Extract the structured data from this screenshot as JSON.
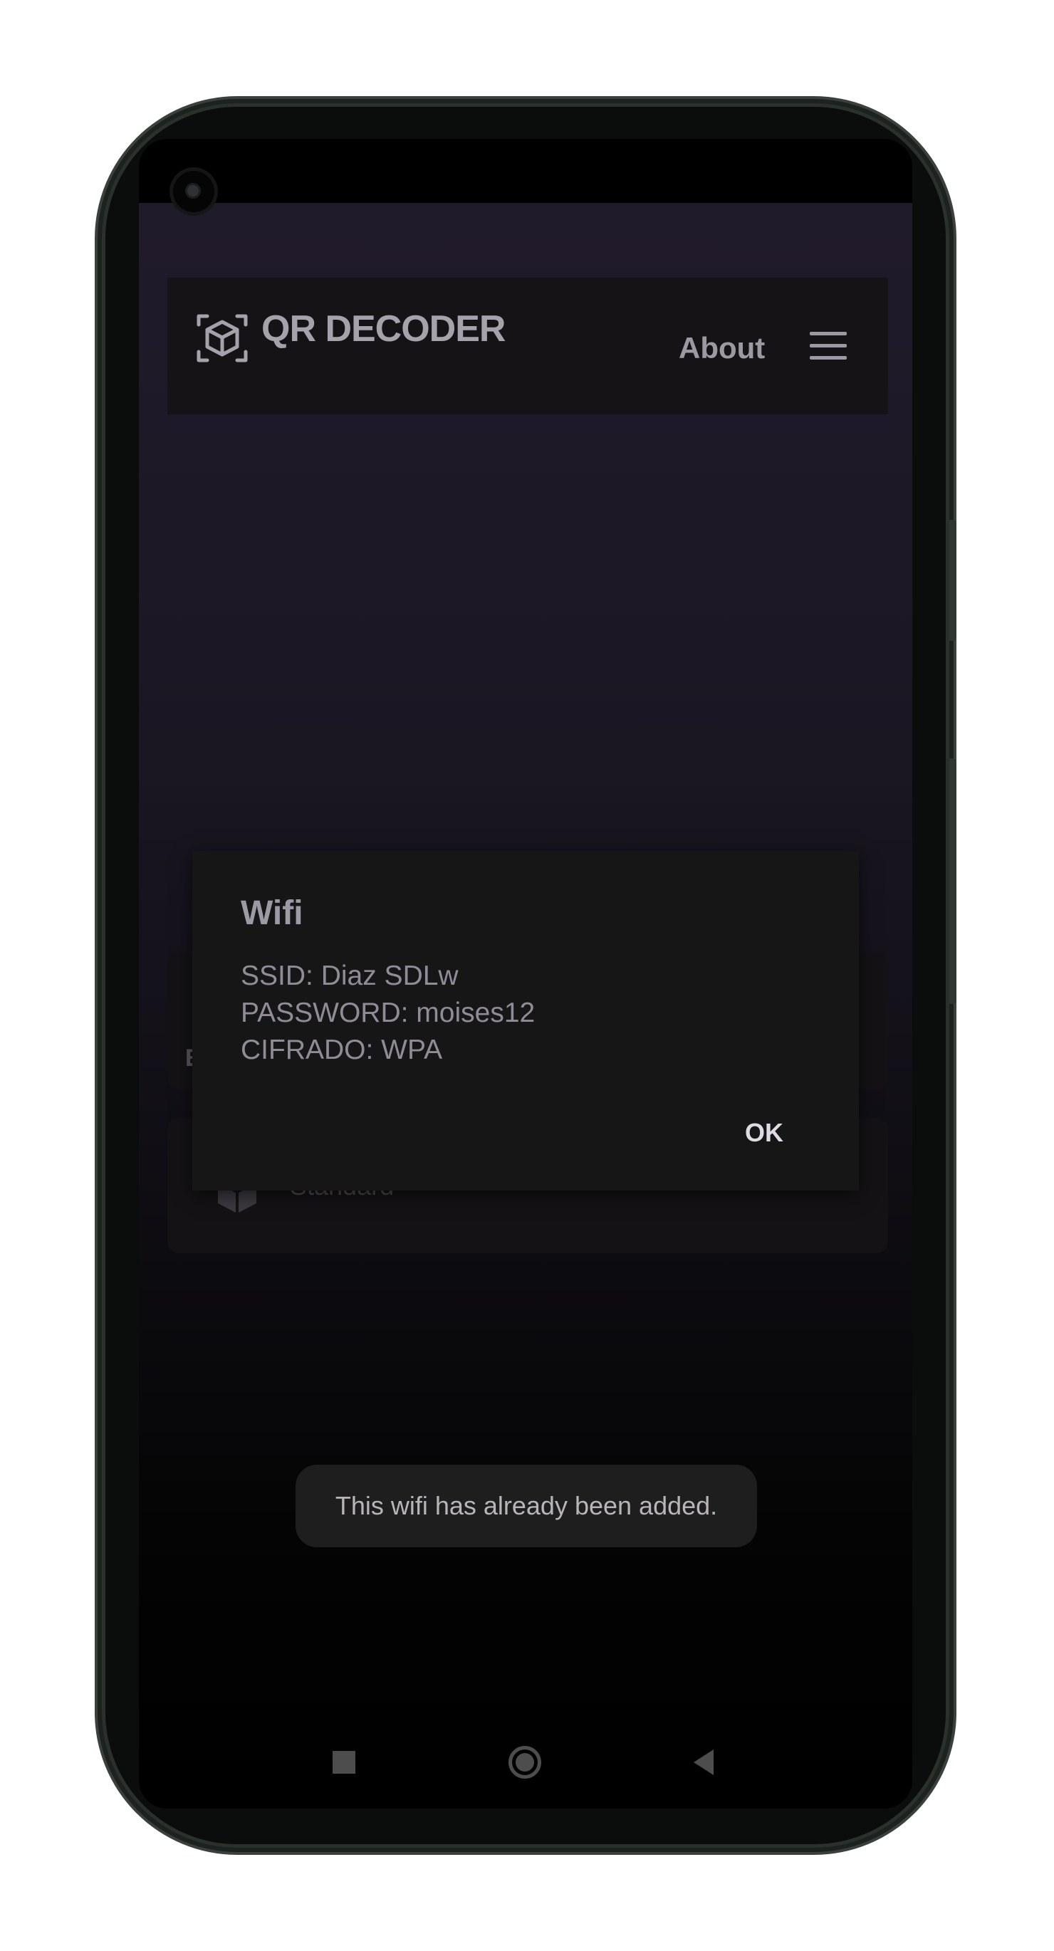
{
  "header": {
    "app_title": "QR DECODER",
    "about_label": "About",
    "logo_icon": "qr-cube-icon",
    "menu_icon": "hamburger-menu-icon"
  },
  "cards": [
    {
      "peek_text": "E"
    },
    {
      "icon": "cube-icon",
      "label": "Standard"
    }
  ],
  "dialog": {
    "title": "Wifi",
    "lines": [
      "SSID: Diaz SDLw",
      "PASSWORD: moises12",
      "CIFRADO: WPA"
    ],
    "ok_label": "OK"
  },
  "toast": {
    "message": "This wifi has already been added."
  },
  "navbar": {
    "recents_icon": "square-icon",
    "home_icon": "circle-icon",
    "back_icon": "triangle-back-icon"
  },
  "colors": {
    "background_top": "#201b2b",
    "bar": "#151316",
    "dialog": "#171617",
    "text_muted": "#9d9aa6"
  }
}
